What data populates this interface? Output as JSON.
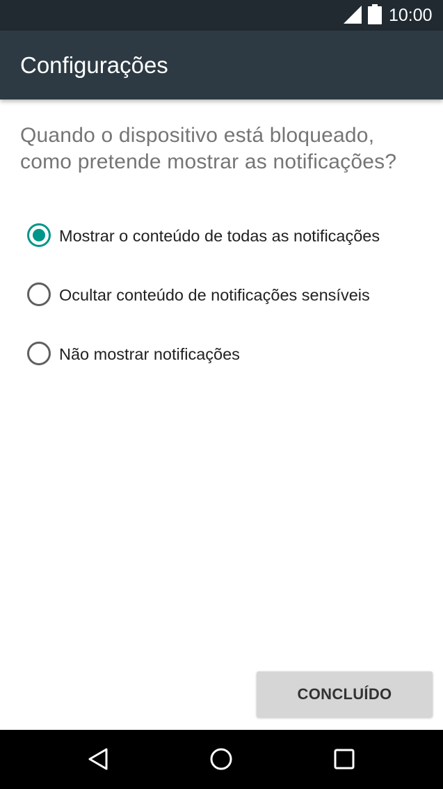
{
  "status_bar": {
    "time": "10:00",
    "icons": [
      "cell-signal-icon",
      "battery-icon"
    ]
  },
  "app_bar": {
    "title": "Configurações"
  },
  "prompt": {
    "question": "Quando o dispositivo está bloqueado, como pretende mostrar as notificações?"
  },
  "options": [
    {
      "label": "Mostrar o conteúdo de todas as notificações",
      "selected": true
    },
    {
      "label": "Ocultar conteúdo de notificações sensíveis",
      "selected": false
    },
    {
      "label": "Não mostrar notificações",
      "selected": false
    }
  ],
  "actions": {
    "done_label": "CONCLUÍDO"
  },
  "nav_bar": {
    "icons": [
      "back-icon",
      "home-icon",
      "recents-icon"
    ]
  },
  "colors": {
    "status_bar": "#212a31",
    "app_bar": "#2d3a43",
    "accent": "#009688",
    "radio_off": "#5f5f5f",
    "question_text": "#757575",
    "button_bg": "#d6d6d6"
  }
}
